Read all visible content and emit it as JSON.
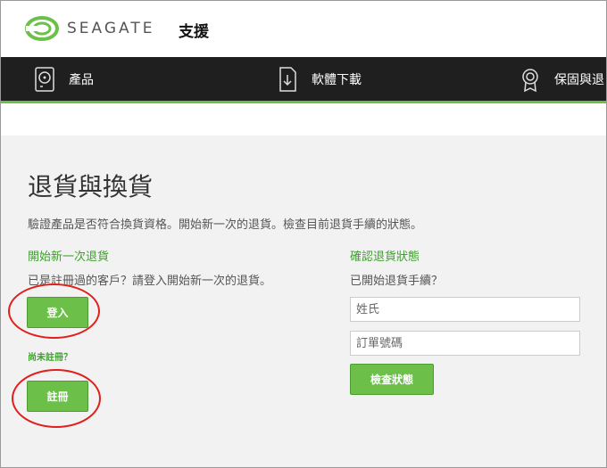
{
  "header": {
    "logo_text": "SEAGATE",
    "support": "支援"
  },
  "nav": {
    "items": [
      {
        "label": "產品",
        "icon": "hard-drive-icon"
      },
      {
        "label": "軟體下載",
        "icon": "download-file-icon"
      },
      {
        "label": "保固與退",
        "icon": "award-badge-icon"
      }
    ]
  },
  "main": {
    "title": "退貨與換貨",
    "description": "驗證產品是否符合換貨資格。開始新一次的退貨。檢查目前退貨手續的狀態。",
    "left": {
      "heading": "開始新一次退貨",
      "text": "已是註冊過的客戶？請登入開始新一次的退貨。",
      "login_button": "登入",
      "not_registered": "尚未註冊？",
      "register_button": "註冊"
    },
    "right": {
      "heading": "確認退貨狀態",
      "text": "已開始退貨手續？",
      "name_placeholder": "姓氏",
      "order_placeholder": "訂單號碼",
      "check_button": "檢查狀態"
    }
  },
  "colors": {
    "accent": "#6cc04a",
    "nav_bg": "#1f1f1f",
    "highlight_ring": "#e0201b"
  }
}
